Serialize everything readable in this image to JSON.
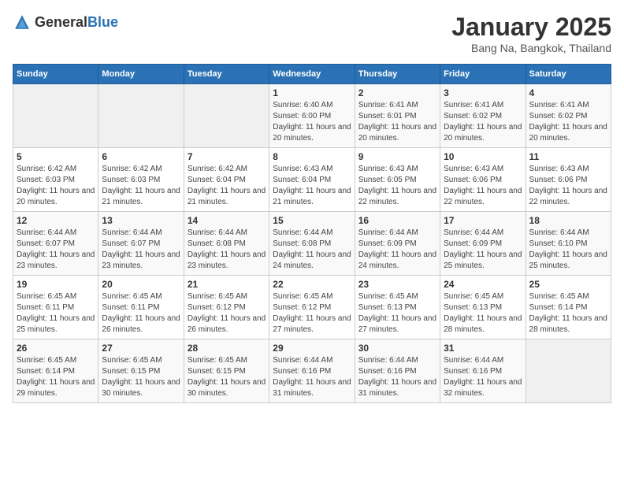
{
  "header": {
    "logo_general": "General",
    "logo_blue": "Blue",
    "title": "January 2025",
    "subtitle": "Bang Na, Bangkok, Thailand"
  },
  "weekdays": [
    "Sunday",
    "Monday",
    "Tuesday",
    "Wednesday",
    "Thursday",
    "Friday",
    "Saturday"
  ],
  "weeks": [
    [
      {
        "day": "",
        "info": ""
      },
      {
        "day": "",
        "info": ""
      },
      {
        "day": "",
        "info": ""
      },
      {
        "day": "1",
        "info": "Sunrise: 6:40 AM\nSunset: 6:00 PM\nDaylight: 11 hours and 20 minutes."
      },
      {
        "day": "2",
        "info": "Sunrise: 6:41 AM\nSunset: 6:01 PM\nDaylight: 11 hours and 20 minutes."
      },
      {
        "day": "3",
        "info": "Sunrise: 6:41 AM\nSunset: 6:02 PM\nDaylight: 11 hours and 20 minutes."
      },
      {
        "day": "4",
        "info": "Sunrise: 6:41 AM\nSunset: 6:02 PM\nDaylight: 11 hours and 20 minutes."
      }
    ],
    [
      {
        "day": "5",
        "info": "Sunrise: 6:42 AM\nSunset: 6:03 PM\nDaylight: 11 hours and 20 minutes."
      },
      {
        "day": "6",
        "info": "Sunrise: 6:42 AM\nSunset: 6:03 PM\nDaylight: 11 hours and 21 minutes."
      },
      {
        "day": "7",
        "info": "Sunrise: 6:42 AM\nSunset: 6:04 PM\nDaylight: 11 hours and 21 minutes."
      },
      {
        "day": "8",
        "info": "Sunrise: 6:43 AM\nSunset: 6:04 PM\nDaylight: 11 hours and 21 minutes."
      },
      {
        "day": "9",
        "info": "Sunrise: 6:43 AM\nSunset: 6:05 PM\nDaylight: 11 hours and 22 minutes."
      },
      {
        "day": "10",
        "info": "Sunrise: 6:43 AM\nSunset: 6:06 PM\nDaylight: 11 hours and 22 minutes."
      },
      {
        "day": "11",
        "info": "Sunrise: 6:43 AM\nSunset: 6:06 PM\nDaylight: 11 hours and 22 minutes."
      }
    ],
    [
      {
        "day": "12",
        "info": "Sunrise: 6:44 AM\nSunset: 6:07 PM\nDaylight: 11 hours and 23 minutes."
      },
      {
        "day": "13",
        "info": "Sunrise: 6:44 AM\nSunset: 6:07 PM\nDaylight: 11 hours and 23 minutes."
      },
      {
        "day": "14",
        "info": "Sunrise: 6:44 AM\nSunset: 6:08 PM\nDaylight: 11 hours and 23 minutes."
      },
      {
        "day": "15",
        "info": "Sunrise: 6:44 AM\nSunset: 6:08 PM\nDaylight: 11 hours and 24 minutes."
      },
      {
        "day": "16",
        "info": "Sunrise: 6:44 AM\nSunset: 6:09 PM\nDaylight: 11 hours and 24 minutes."
      },
      {
        "day": "17",
        "info": "Sunrise: 6:44 AM\nSunset: 6:09 PM\nDaylight: 11 hours and 25 minutes."
      },
      {
        "day": "18",
        "info": "Sunrise: 6:44 AM\nSunset: 6:10 PM\nDaylight: 11 hours and 25 minutes."
      }
    ],
    [
      {
        "day": "19",
        "info": "Sunrise: 6:45 AM\nSunset: 6:11 PM\nDaylight: 11 hours and 25 minutes."
      },
      {
        "day": "20",
        "info": "Sunrise: 6:45 AM\nSunset: 6:11 PM\nDaylight: 11 hours and 26 minutes."
      },
      {
        "day": "21",
        "info": "Sunrise: 6:45 AM\nSunset: 6:12 PM\nDaylight: 11 hours and 26 minutes."
      },
      {
        "day": "22",
        "info": "Sunrise: 6:45 AM\nSunset: 6:12 PM\nDaylight: 11 hours and 27 minutes."
      },
      {
        "day": "23",
        "info": "Sunrise: 6:45 AM\nSunset: 6:13 PM\nDaylight: 11 hours and 27 minutes."
      },
      {
        "day": "24",
        "info": "Sunrise: 6:45 AM\nSunset: 6:13 PM\nDaylight: 11 hours and 28 minutes."
      },
      {
        "day": "25",
        "info": "Sunrise: 6:45 AM\nSunset: 6:14 PM\nDaylight: 11 hours and 28 minutes."
      }
    ],
    [
      {
        "day": "26",
        "info": "Sunrise: 6:45 AM\nSunset: 6:14 PM\nDaylight: 11 hours and 29 minutes."
      },
      {
        "day": "27",
        "info": "Sunrise: 6:45 AM\nSunset: 6:15 PM\nDaylight: 11 hours and 30 minutes."
      },
      {
        "day": "28",
        "info": "Sunrise: 6:45 AM\nSunset: 6:15 PM\nDaylight: 11 hours and 30 minutes."
      },
      {
        "day": "29",
        "info": "Sunrise: 6:44 AM\nSunset: 6:16 PM\nDaylight: 11 hours and 31 minutes."
      },
      {
        "day": "30",
        "info": "Sunrise: 6:44 AM\nSunset: 6:16 PM\nDaylight: 11 hours and 31 minutes."
      },
      {
        "day": "31",
        "info": "Sunrise: 6:44 AM\nSunset: 6:16 PM\nDaylight: 11 hours and 32 minutes."
      },
      {
        "day": "",
        "info": ""
      }
    ]
  ]
}
